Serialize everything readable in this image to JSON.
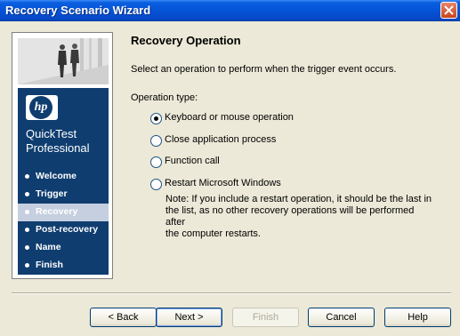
{
  "window": {
    "title": "Recovery Scenario Wizard"
  },
  "sidebar": {
    "logo_text": "hp",
    "product_line1": "QuickTest",
    "product_line2": "Professional",
    "steps": [
      {
        "label": "Welcome",
        "active": false
      },
      {
        "label": "Trigger",
        "active": false
      },
      {
        "label": "Recovery",
        "active": true
      },
      {
        "label": "Post-recovery",
        "active": false
      },
      {
        "label": "Name",
        "active": false
      },
      {
        "label": "Finish",
        "active": false
      }
    ]
  },
  "main": {
    "title": "Recovery Operation",
    "description": "Select an operation to perform when the trigger event occurs.",
    "operation_type_label": "Operation type:",
    "options": [
      {
        "label": "Keyboard or mouse operation",
        "selected": true
      },
      {
        "label": "Close application process",
        "selected": false
      },
      {
        "label": "Function call",
        "selected": false
      },
      {
        "label": "Restart Microsoft Windows",
        "selected": false
      }
    ],
    "note_lines": [
      "Note: If you include a restart operation, it should be the last in",
      "the list, as no other recovery operations will be performed after",
      "the computer restarts."
    ]
  },
  "buttons": {
    "back": "< Back",
    "next": "Next >",
    "finish": "Finish",
    "cancel": "Cancel",
    "help": "Help"
  },
  "colors": {
    "titlebar": "#0553d6",
    "panel": "#0f3d6f",
    "active_step": "#c6cfdf"
  }
}
